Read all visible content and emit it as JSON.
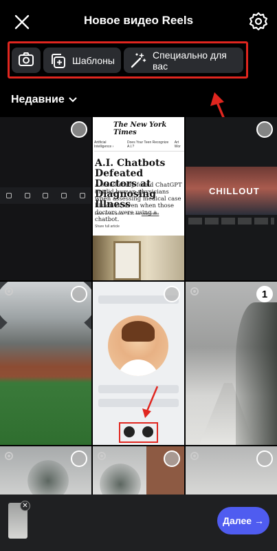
{
  "header": {
    "title": "Новое видео Reels",
    "close_icon": "close-icon",
    "settings_icon": "gear-icon"
  },
  "tools": {
    "camera_icon": "camera-icon",
    "templates_label": "Шаблоны",
    "for_you_label": "Специально для вас"
  },
  "filter": {
    "label": "Недавние"
  },
  "grid": {
    "nyt": {
      "logo": "The New York Times",
      "tab1": "Artificial Intelligence ›",
      "tab2": "Does Your Teen Recognize A.I.?",
      "tab3": "Art Wor",
      "headline": "A.I. Chatbots Defeated Doctors at Diagnosing Illness",
      "summary": "A small study found ChatGPT outdid human physicians when assessing medical case histories, even when those doctors were using a chatbot.",
      "listen": "Listen to this article · 8:26 min",
      "learn_more": "Learn more",
      "share": "Share full article"
    },
    "chillout": {
      "title": "CHILLOUT"
    },
    "selected_number": "1"
  },
  "footer": {
    "next_label": "Далее →"
  },
  "colors": {
    "accent": "#4f5cf0",
    "highlight_red": "#e0261f"
  }
}
